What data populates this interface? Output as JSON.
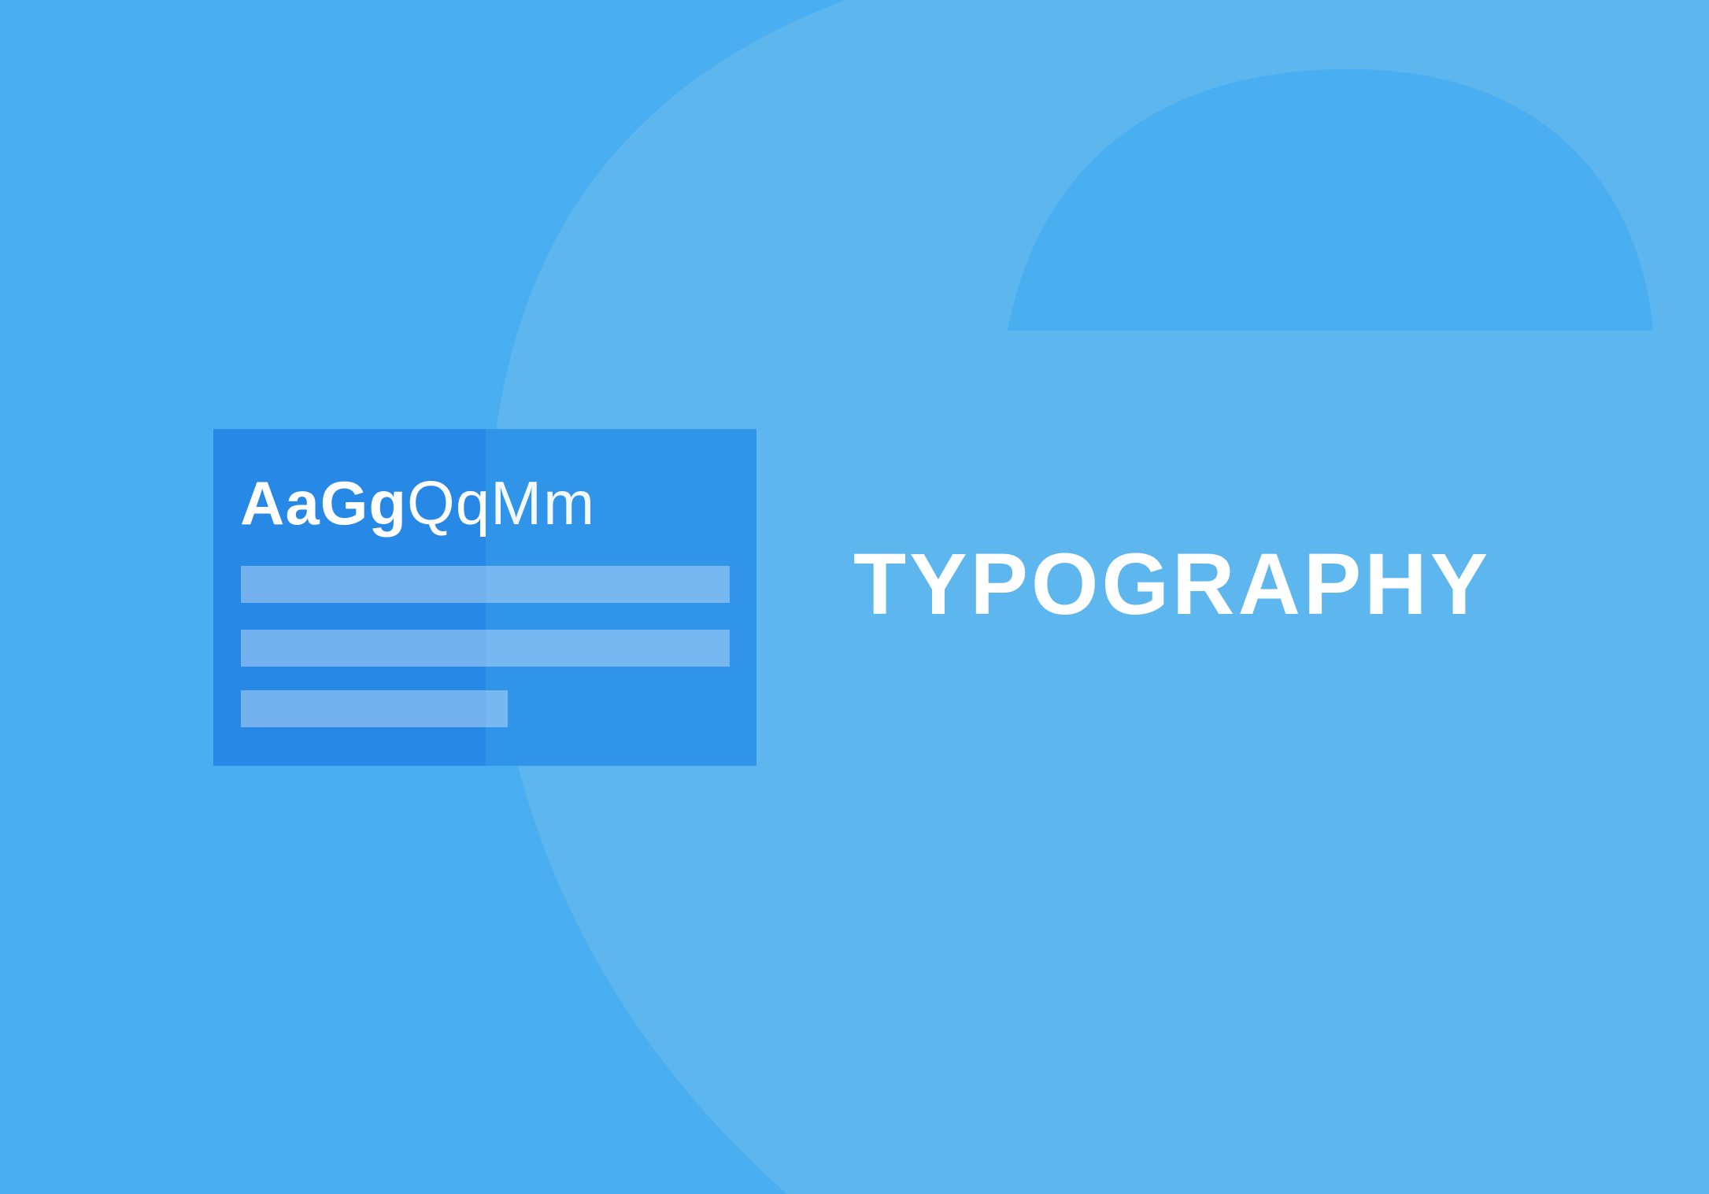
{
  "colors": {
    "background": "#49aff1",
    "letter_shape": "#5eb6ee",
    "card_left": "#2788e6",
    "card_right": "#3094e8",
    "text": "#ffffff"
  },
  "card": {
    "specimen_bold": "AaGg",
    "specimen_regular": "Qq",
    "specimen_light": "Mm"
  },
  "headline": "TYPOGRAPHY"
}
